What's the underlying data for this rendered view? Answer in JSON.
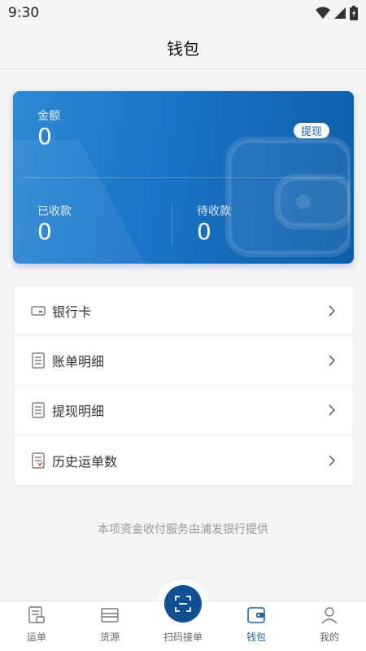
{
  "status": {
    "time": "9:30"
  },
  "header": {
    "title": "钱包"
  },
  "wallet": {
    "amount_label": "金额",
    "amount_value": "0",
    "withdraw_label": "提现",
    "received_label": "已收款",
    "received_value": "0",
    "pending_label": "待收款",
    "pending_value": "0"
  },
  "menu": {
    "items": [
      {
        "label": "银行卡",
        "icon": "bank-card-icon"
      },
      {
        "label": "账单明细",
        "icon": "bill-detail-icon"
      },
      {
        "label": "提现明细",
        "icon": "withdraw-detail-icon"
      },
      {
        "label": "历史运单数",
        "icon": "history-order-icon"
      }
    ]
  },
  "footer_note": "本项资金收付服务由浦发银行提供",
  "nav": {
    "items": [
      {
        "label": "运单",
        "icon": "waybill-icon"
      },
      {
        "label": "货源",
        "icon": "cargo-icon"
      },
      {
        "label": "扫码接单",
        "icon": "scan-icon"
      },
      {
        "label": "钱包",
        "icon": "wallet-icon"
      },
      {
        "label": "我的",
        "icon": "profile-icon"
      }
    ],
    "active_index": 3
  },
  "colors": {
    "primary": "#1a64b3",
    "card_start": "#2d8ad6",
    "card_end": "#0d5ea9"
  }
}
